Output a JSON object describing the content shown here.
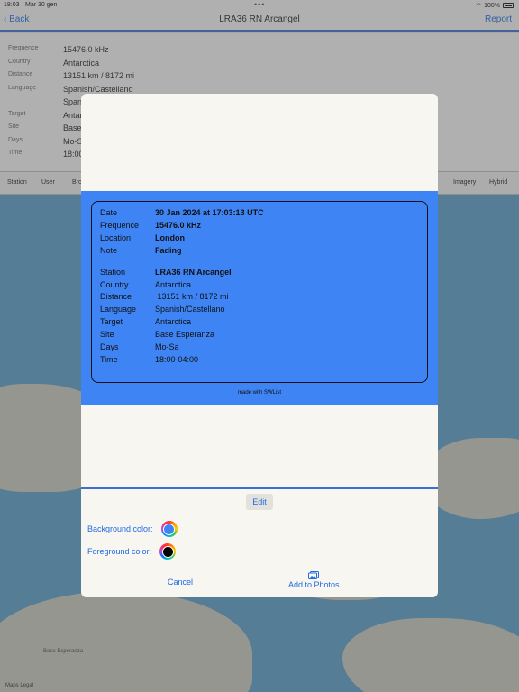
{
  "status_bar": {
    "time": "18:03",
    "date": "Mar 30 gen",
    "battery": "100%"
  },
  "navbar": {
    "back_label": "Back",
    "title": "LRA36 RN Arcangel",
    "report_label": "Report"
  },
  "detail": {
    "rows": [
      {
        "key": "Frequence",
        "value": "15476,0 kHz"
      },
      {
        "key": "Country",
        "value": "Antarctica"
      },
      {
        "key": "Distance",
        "value": "13151 km / 8172 mi"
      },
      {
        "key": "Language",
        "value": "Spanish/Castellano"
      },
      {
        "key": "",
        "value": "Spanish"
      },
      {
        "key": "Target",
        "value": "Antarctica"
      },
      {
        "key": "Site",
        "value": "Base Esperanza"
      },
      {
        "key": "Days",
        "value": "Mo-Sa"
      },
      {
        "key": "Time",
        "value": "18:00-04:00"
      }
    ]
  },
  "tabs": [
    "Station",
    "User",
    "Bro",
    "Imagery",
    "Hybrid"
  ],
  "map": {
    "label": "Base Esperanza",
    "legal": "Maps  Legal"
  },
  "card": {
    "background_color": "#3e84f4",
    "foreground_color": "#000000",
    "rows_top": [
      {
        "label": "Date",
        "value": "30 Jan 2024 at 17:03:13 UTC"
      },
      {
        "label": "Frequence",
        "value": "15476.0 kHz"
      },
      {
        "label": "Location",
        "value": "London"
      },
      {
        "label": "Note",
        "value": "Fading"
      }
    ],
    "rows_bottom": [
      {
        "label": "Station",
        "value": "LRA36 RN Arcangel"
      },
      {
        "label": "Country",
        "value": "Antarctica"
      },
      {
        "label": "Distance",
        "value": " 13151 km / 8172 mi"
      },
      {
        "label": "Language",
        "value": "Spanish/Castellano"
      },
      {
        "label": "Target",
        "value": "Antarctica"
      },
      {
        "label": "Site",
        "value": "Base Esperanza"
      },
      {
        "label": "Days",
        "value": "Mo-Sa"
      },
      {
        "label": "Time",
        "value": "18:00-04:00"
      }
    ],
    "made_with": "made with SWList"
  },
  "controls": {
    "edit_label": "Edit",
    "background_color_label": "Background color:",
    "foreground_color_label": "Foreground color:",
    "cancel_label": "Cancel",
    "add_to_photos_label": "Add to Photos"
  }
}
